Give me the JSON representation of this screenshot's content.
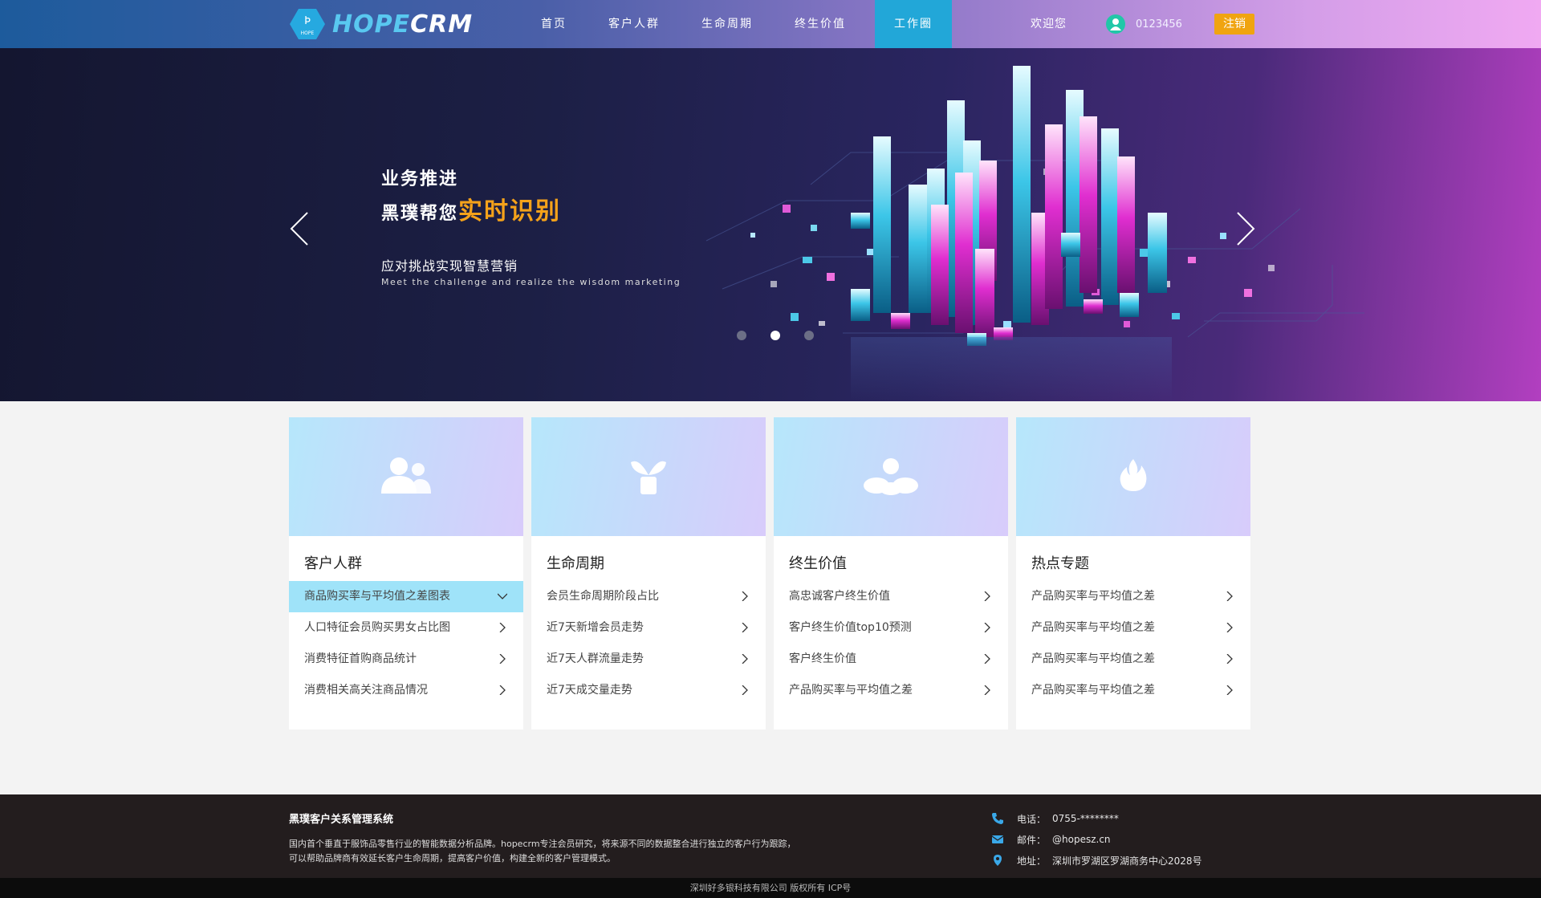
{
  "header": {
    "logo_text_hope": "HOPE",
    "logo_text_crm": "CRM",
    "logo_badge": "HOPE",
    "nav": [
      {
        "label": "首页"
      },
      {
        "label": "客户人群"
      },
      {
        "label": "生命周期"
      },
      {
        "label": "终生价值"
      },
      {
        "label": "工作圈"
      }
    ],
    "active_nav": "工作圈",
    "welcome": "欢迎您",
    "username": "0123456",
    "logout": "注销"
  },
  "banner": {
    "title1": "业务推进",
    "title2_prefix": "黑璞帮您",
    "title2_highlight": "实时识别",
    "subtitle": "应对挑战实现智慧营销",
    "subtitle_en": "Meet the challenge and realize the wisdom marketing",
    "active_slide": 2,
    "slide_count": 3
  },
  "cards": [
    {
      "title": "客户人群",
      "icon": "users-icon",
      "items": [
        "商品购买率与平均值之差图表",
        "人口特征会员购买男女占比图",
        "消费特征首购商品统计",
        "消费相关高关注商品情况"
      ],
      "active_item": 0
    },
    {
      "title": "生命周期",
      "icon": "plant-icon",
      "items": [
        "会员生命周期阶段占比",
        "近7天新增会员走势",
        "近7天人群流量走势",
        "近7天成交量走势"
      ]
    },
    {
      "title": "终生价值",
      "icon": "coins-icon",
      "items": [
        "高忠诚客户终生价值",
        "客户终生价值top10预测",
        "客户终生价值",
        "产品购买率与平均值之差"
      ]
    },
    {
      "title": "热点专题",
      "icon": "fire-icon",
      "items": [
        "产品购买率与平均值之差",
        "产品购买率与平均值之差",
        "产品购买率与平均值之差",
        "产品购买率与平均值之差"
      ]
    }
  ],
  "footer": {
    "title": "黑璞客户关系管理系统",
    "desc1": "国内首个垂直于服饰品零售行业的智能数据分析品牌。hopecrm专注会员研究，将来源不同的数据整合进行独立的客户行为跟踪，",
    "desc2": "可以帮助品牌商有效延长客户生命周期，提高客户价值，构建全新的客户管理模式。",
    "phone_label": "电话：",
    "phone": "0755-********",
    "email_label": "邮件：",
    "email": "@hopesz.cn",
    "address_label": "地址：",
    "address": "深圳市罗湖区罗湖商务中心2028号",
    "copyright": "深圳好多银科技有限公司 版权所有 ICP号"
  },
  "colors": {
    "accent": "#22a7d8",
    "logout": "#f0a410",
    "highlight": "#f5a21a",
    "active_row": "#9fe3f9"
  }
}
